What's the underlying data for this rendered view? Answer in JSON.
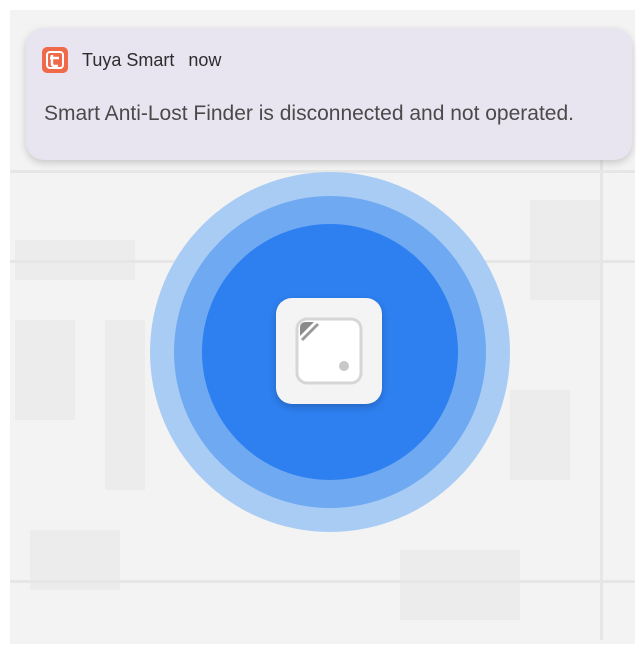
{
  "notification": {
    "app_icon": "tuya-app-icon",
    "app_name": "Tuya Smart",
    "time": "now",
    "message": "Smart Anti-Lost Finder is disconnected and not operated."
  },
  "device": {
    "icon": "anti-lost-finder-tag-icon"
  },
  "colors": {
    "app_icon": "#ef6a4a",
    "notification_bg": "#e9e5f0",
    "radar_outer": "#a9ccf5",
    "radar_middle": "#6ea9f1",
    "radar_inner": "#2e7ff0"
  }
}
